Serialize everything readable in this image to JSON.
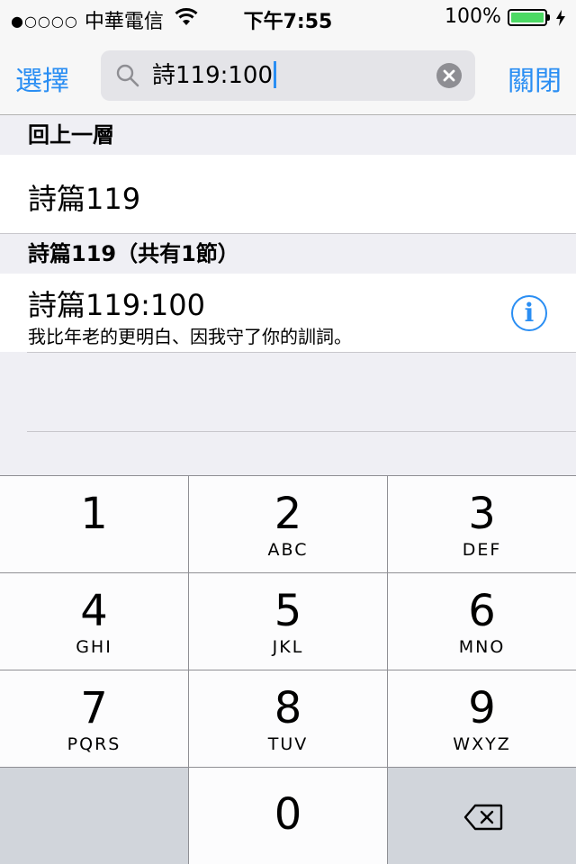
{
  "status_bar": {
    "signal_dots": "●○○○○",
    "carrier": "中華電信",
    "time": "下午7:55",
    "battery_percent": "100%",
    "battery_level": 1.0,
    "battery_color": "#4cd964"
  },
  "search_bar": {
    "select_label": "選擇",
    "query": "詩119:100",
    "close_label": "關閉",
    "accent_color": "#2a8ef3"
  },
  "results": {
    "sections": [
      {
        "header": "回上一層",
        "rows": [
          {
            "title": "詩篇119"
          }
        ]
      },
      {
        "header": "詩篇119（共有1節）",
        "rows": [
          {
            "title": "詩篇119:100",
            "subtitle": "我比年老的更明白、因我守了你的訓詞。",
            "accessory_icon": "info-icon"
          }
        ]
      }
    ]
  },
  "keypad": {
    "keys": [
      {
        "digit": "1",
        "letters": ""
      },
      {
        "digit": "2",
        "letters": "ABC"
      },
      {
        "digit": "3",
        "letters": "DEF"
      },
      {
        "digit": "4",
        "letters": "GHI"
      },
      {
        "digit": "5",
        "letters": "JKL"
      },
      {
        "digit": "6",
        "letters": "MNO"
      },
      {
        "digit": "7",
        "letters": "PQRS"
      },
      {
        "digit": "8",
        "letters": "TUV"
      },
      {
        "digit": "9",
        "letters": "WXYZ"
      },
      {
        "digit": "0",
        "letters": ""
      }
    ],
    "delete_icon": "backspace-icon"
  }
}
